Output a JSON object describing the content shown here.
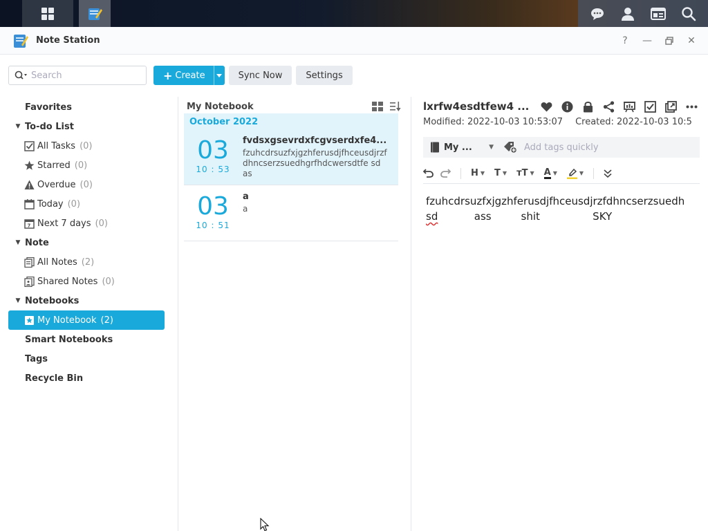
{
  "app": {
    "title": "Note Station"
  },
  "toolbar": {
    "search_placeholder": "Search",
    "create_label": "Create",
    "sync_label": "Sync Now",
    "settings_label": "Settings"
  },
  "sidebar": {
    "favorites": "Favorites",
    "todo": {
      "label": "To-do List",
      "items": [
        {
          "label": "All Tasks",
          "count": "(0)"
        },
        {
          "label": "Starred",
          "count": "(0)"
        },
        {
          "label": "Overdue",
          "count": "(0)"
        },
        {
          "label": "Today",
          "count": "(0)"
        },
        {
          "label": "Next 7 days",
          "count": "(0)"
        }
      ]
    },
    "note": {
      "label": "Note",
      "items": [
        {
          "label": "All Notes",
          "count": "(2)"
        },
        {
          "label": "Shared Notes",
          "count": "(0)"
        }
      ]
    },
    "notebooks": {
      "label": "Notebooks",
      "items": [
        {
          "label": "My Notebook",
          "count": "(2)"
        }
      ]
    },
    "smart_notebooks": "Smart Notebooks",
    "tags": "Tags",
    "recycle_bin": "Recycle Bin"
  },
  "notelist": {
    "title": "My Notebook",
    "month": "October 2022",
    "notes": [
      {
        "day": "03",
        "time": "10 : 53",
        "title": "fvdsxgsevrdxfcgvserdxfe4...",
        "body": "fzuhcdrsuzfxjgzhferusdjfhceusdjrzfdhncserzsuedhgrfhdcwersdtfe sd            as"
      },
      {
        "day": "03",
        "time": "10 : 51",
        "title": "a",
        "body": "a"
      }
    ]
  },
  "editor": {
    "title": "lxrfw4esdtfew4 ...",
    "modified": "Modified: 2022-10-03 10:53:07",
    "created": "Created: 2022-10-03 10:5",
    "notebook": "My ...",
    "tags_placeholder": "Add tags quickly",
    "format": {
      "heading": "H",
      "text": "T",
      "size": "тT",
      "color": "A"
    },
    "content_line1": "fzuhcdrsuzfxjgzhferusdjfhceusdjrzfdhncserzsuedh",
    "content_line2_a": "sd",
    "content_line2_b": "           ass         shit                SKY"
  },
  "colors": {
    "accent": "#1aa9db",
    "selected_bg": "#e2f4fb"
  }
}
